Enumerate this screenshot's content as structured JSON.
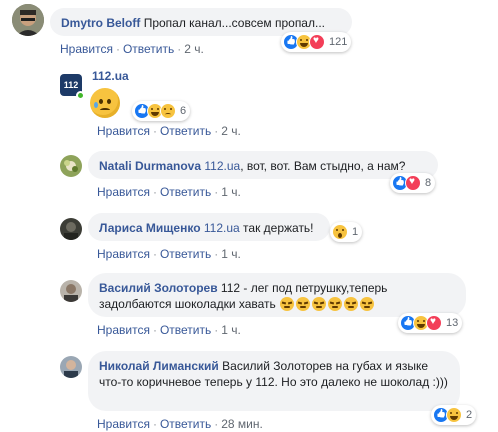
{
  "comments": [
    {
      "name": "Dmytro Beloff",
      "text": "Пропал канал...совсем пропал...",
      "like": "Нравится",
      "reply": "Ответить",
      "time": "2 ч.",
      "reactions_count": "121",
      "reactions": [
        "like",
        "haha",
        "love"
      ]
    },
    {
      "name": "112.ua",
      "like": "Нравится",
      "reply": "Ответить",
      "time": "2 ч.",
      "reactions_count": "6",
      "reactions": [
        "like",
        "haha",
        "sad"
      ],
      "logo_text": "112"
    },
    {
      "name": "Natali Durmanova",
      "mention": "112.ua",
      "text": ", вот, вот. Вам стыдно, а нам?",
      "like": "Нравится",
      "reply": "Ответить",
      "time": "1 ч.",
      "reactions_count": "8",
      "reactions": [
        "like",
        "love"
      ]
    },
    {
      "name": "Лариса Мищенко",
      "mention": "112.ua",
      "text": "так держать!",
      "like": "Нравится",
      "reply": "Ответить",
      "time": "1 ч.",
      "reactions_count": "1",
      "reactions": [
        "wow"
      ]
    },
    {
      "name": "Василий Золоторев",
      "text": "112 - лег под петрушку,теперь задолбаются шоколадки хавать",
      "like": "Нравится",
      "reply": "Ответить",
      "time": "1 ч.",
      "reactions_count": "13",
      "reactions": [
        "like",
        "haha",
        "love"
      ]
    },
    {
      "name": "Николай Лиманский",
      "text": "Василий Золоторев на губах и языке что-то коричневое теперь у 112. Но это далеко не шоколад :)))",
      "like": "Нравится",
      "reply": "Ответить",
      "time": "28 мин.",
      "reactions_count": "2",
      "reactions": [
        "like",
        "haha"
      ]
    }
  ],
  "colors": {
    "link": "#385898",
    "bubble": "#f2f3f5",
    "like": "#1877f2",
    "love": "#f33e58",
    "haha": "#f7c33f"
  }
}
